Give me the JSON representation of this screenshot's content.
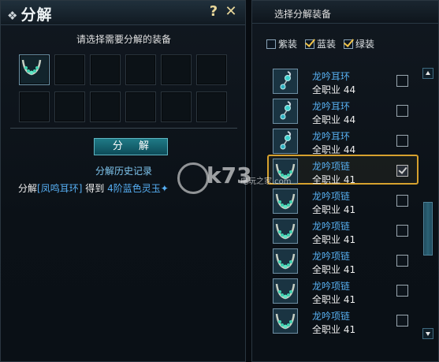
{
  "decompose_window": {
    "title": "分解",
    "help_glyph": "?",
    "close_glyph": "✕",
    "instruction": "请选择需要分解的装备",
    "slots": [
      {
        "filled": true,
        "icon": "necklace-icon"
      },
      {
        "filled": false
      },
      {
        "filled": false
      },
      {
        "filled": false
      },
      {
        "filled": false
      },
      {
        "filled": false
      },
      {
        "filled": false
      },
      {
        "filled": false
      },
      {
        "filled": false
      },
      {
        "filled": false
      },
      {
        "filled": false
      },
      {
        "filled": false
      }
    ],
    "decompose_button": "分 解",
    "history_title": "分解历史记录",
    "history_entry": {
      "prefix": "分解",
      "item": "[凤鸣耳环]",
      "mid": "得到",
      "result": "4阶蓝色灵玉"
    }
  },
  "selection_window": {
    "title": "选择分解装备",
    "filters": [
      {
        "label": "紫装",
        "checked": false
      },
      {
        "label": "蓝装",
        "checked": true
      },
      {
        "label": "绿装",
        "checked": true
      }
    ],
    "items": [
      {
        "name": "龙吟耳环",
        "class": "全职业",
        "level": "44",
        "icon": "earring-icon",
        "checked": false,
        "selected": false
      },
      {
        "name": "龙吟耳环",
        "class": "全职业",
        "level": "44",
        "icon": "earring-icon",
        "checked": false,
        "selected": false
      },
      {
        "name": "龙吟耳环",
        "class": "全职业",
        "level": "44",
        "icon": "earring-icon",
        "checked": false,
        "selected": false
      },
      {
        "name": "龙吟项链",
        "class": "全职业",
        "level": "41",
        "icon": "necklace-icon",
        "checked": true,
        "selected": true
      },
      {
        "name": "龙吟项链",
        "class": "全职业",
        "level": "41",
        "icon": "necklace-icon",
        "checked": false,
        "selected": false
      },
      {
        "name": "龙吟项链",
        "class": "全职业",
        "level": "41",
        "icon": "necklace-icon",
        "checked": false,
        "selected": false
      },
      {
        "name": "龙吟项链",
        "class": "全职业",
        "level": "41",
        "icon": "necklace-icon",
        "checked": false,
        "selected": false
      },
      {
        "name": "龙吟项链",
        "class": "全职业",
        "level": "41",
        "icon": "necklace-icon",
        "checked": false,
        "selected": false
      },
      {
        "name": "龙吟项链",
        "class": "全职业",
        "level": "41",
        "icon": "necklace-icon",
        "checked": false,
        "selected": false
      }
    ]
  },
  "watermark": {
    "logo": "k73",
    "sub": "电玩之家",
    "suffix": ".com"
  },
  "colors": {
    "item_name": "#57aff0",
    "highlight": "#d6a12e",
    "button": "#1f7a86"
  }
}
